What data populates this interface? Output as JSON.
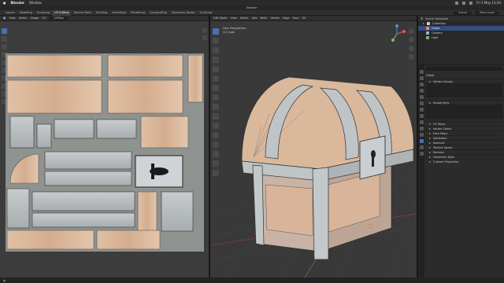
{
  "macos": {
    "app": "Blender",
    "menu": [
      "Window"
    ],
    "datetime": "Fri 1 May 13:34"
  },
  "window": {
    "title": "Blender"
  },
  "workspaces": {
    "tabs": [
      "Layout",
      "Modeling",
      "Sculpting",
      "UV Editing",
      "Texture Paint",
      "Shading",
      "Animation",
      "Rendering",
      "Compositing",
      "Geometry Nodes",
      "Scripting"
    ],
    "active_index": 3,
    "scene": "Scene",
    "view_layer": "View Layer"
  },
  "uv_editor": {
    "header": [
      "View",
      "Select",
      "Image",
      "UV"
    ],
    "image_field": "UVMap"
  },
  "viewport": {
    "header": [
      "Edit Mode",
      "View",
      "Select",
      "Add",
      "Mesh",
      "Vertex",
      "Edge",
      "Face",
      "UV"
    ],
    "overlay_line1": "User Perspective",
    "overlay_line2": "(1) Cube"
  },
  "outliner": {
    "title": "Scene Collection",
    "rows": [
      {
        "label": "Collection",
        "icon": "collection-icon"
      },
      {
        "label": "Chest",
        "icon": "mesh-icon"
      },
      {
        "label": "Camera",
        "icon": "camera-icon"
      },
      {
        "label": "Light",
        "icon": "light-icon"
      }
    ]
  },
  "properties": {
    "name_field": "Chest",
    "sections": [
      "Vertex Groups",
      "Shape Keys",
      "UV Maps",
      "Vertex Colors",
      "Face Maps",
      "Attributes",
      "Normals",
      "Texture Space",
      "Remesh",
      "Geometry Data",
      "Custom Properties"
    ]
  },
  "colors": {
    "accent": "#4772b3",
    "wood": "#d8b59a",
    "metal": "#bfc4c6",
    "uv_background": "#8e928e"
  }
}
